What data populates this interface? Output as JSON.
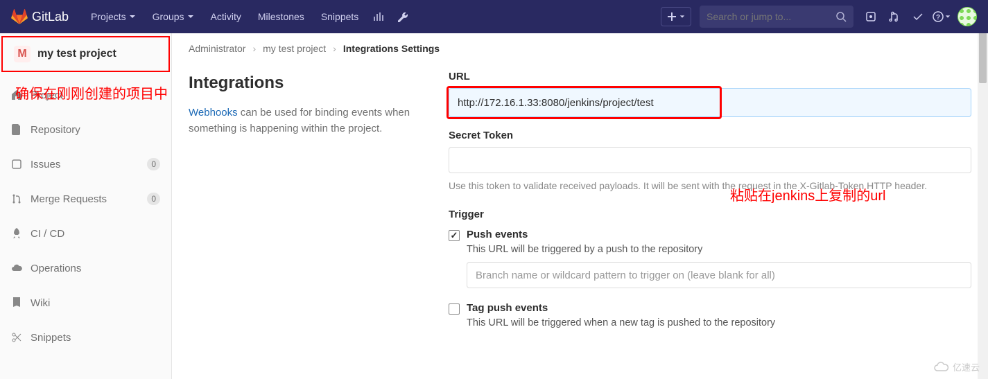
{
  "header": {
    "brand": "GitLab",
    "nav": {
      "projects": "Projects",
      "groups": "Groups",
      "activity": "Activity",
      "milestones": "Milestones",
      "snippets": "Snippets"
    },
    "search_placeholder": "Search or jump to..."
  },
  "sidebar": {
    "project_letter": "M",
    "project_name": "my test project",
    "items": {
      "project": "Project",
      "repository": "Repository",
      "issues": "Issues",
      "issues_count": "0",
      "merge_requests": "Merge Requests",
      "mr_count": "0",
      "cicd": "CI / CD",
      "operations": "Operations",
      "wiki": "Wiki",
      "snippets": "Snippets"
    }
  },
  "breadcrumb": {
    "owner": "Administrator",
    "project": "my test project",
    "page": "Integrations Settings"
  },
  "content": {
    "title": "Integrations",
    "webhooks_link": "Webhooks",
    "desc_rest": " can be used for binding events when something is happening within the project."
  },
  "form": {
    "url_label": "URL",
    "url_value": "http://172.16.1.33:8080/jenkins/project/test",
    "token_label": "Secret Token",
    "token_help": "Use this token to validate received payloads. It will be sent with the request in the X-Gitlab-Token HTTP header.",
    "trigger_label": "Trigger",
    "push": {
      "label": "Push events",
      "desc": "This URL will be triggered by a push to the repository",
      "branch_placeholder": "Branch name or wildcard pattern to trigger on (leave blank for all)"
    },
    "tag": {
      "label": "Tag push events",
      "desc": "This URL will be triggered when a new tag is pushed to the repository"
    }
  },
  "annotations": {
    "ann1": "确保在刚刚创建的项目中",
    "ann2": "粘贴在jenkins上复制的url"
  },
  "watermark": "亿速云"
}
